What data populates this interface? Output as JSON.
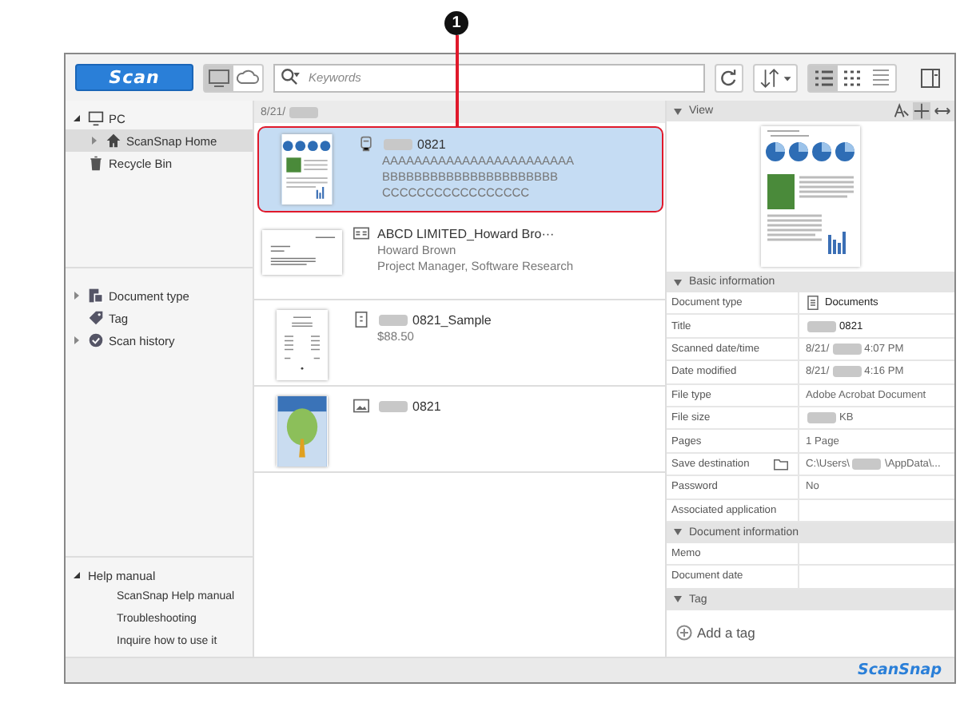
{
  "callout": {
    "label": "1"
  },
  "toolbar": {
    "scan_button": "Scan",
    "search": {
      "placeholder": "Keywords"
    }
  },
  "sidebar": {
    "tree": [
      {
        "label": "PC",
        "expanded": true,
        "selected": false,
        "children": [
          {
            "label": "ScanSnap Home",
            "expanded": false,
            "selected": true
          }
        ]
      },
      {
        "label": "Recycle Bin",
        "selected": false
      }
    ],
    "categories": [
      {
        "label": "Document type",
        "expandable": true
      },
      {
        "label": "Tag",
        "expandable": false
      },
      {
        "label": "Scan history",
        "expandable": true
      }
    ],
    "help": {
      "title": "Help manual",
      "expanded": true,
      "links": [
        "ScanSnap Help manual",
        "Troubleshooting",
        "Inquire how to use it"
      ]
    }
  },
  "list": {
    "date_header": "8/21/",
    "date_redacted": true,
    "items": [
      {
        "kind": "document",
        "title": "0821",
        "redacted": true,
        "lines": [
          "AAAAAAAAAAAAAAAAAAAAAAAA",
          "BBBBBBBBBBBBBBBBBBBBBB",
          "CCCCCCCCCCCCCCCCC"
        ],
        "selected": true
      },
      {
        "kind": "card",
        "title": "ABCD LIMITED_Howard Bro···",
        "redacted": false,
        "lines": [
          "Howard Brown",
          "Project Manager, Software Research"
        ],
        "selected": false
      },
      {
        "kind": "receipt",
        "title": "0821_Sample",
        "redacted": true,
        "lines": [
          "$88.50"
        ],
        "selected": false
      },
      {
        "kind": "photo",
        "title": "0821",
        "redacted": true,
        "selected": false
      }
    ]
  },
  "details": {
    "view": {
      "title": "View",
      "expanded": true
    },
    "sections": [
      {
        "title": "Basic information",
        "expanded": true,
        "rows": [
          {
            "label": "Document type",
            "after": "Documents"
          },
          {
            "label": "Title",
            "redacted": true,
            "after": "0821"
          },
          {
            "label": "Scanned date/time",
            "before": "8/21/",
            "redacted": true,
            "after": "4:07 PM"
          },
          {
            "label": "Date modified",
            "before": "8/21/",
            "redacted": true,
            "after": "4:16 PM"
          },
          {
            "label": "File type",
            "after": "Adobe Acrobat Document"
          },
          {
            "label": "File size",
            "redacted": true,
            "after": "KB"
          },
          {
            "label": "Pages",
            "after": "1 Page"
          },
          {
            "label": "Save destination",
            "before": "C:\\Users\\",
            "redacted": true,
            "after": "\\AppData\\..."
          },
          {
            "label": "Password",
            "after": "No"
          },
          {
            "label": "Associated application"
          }
        ]
      },
      {
        "title": "Document information",
        "expanded": true,
        "rows": [
          {
            "label": "Memo"
          },
          {
            "label": "Document date"
          }
        ]
      },
      {
        "title": "Tag",
        "expanded": true,
        "action": "Add a tag"
      }
    ]
  },
  "footer": {
    "logo": "ScanSnap"
  }
}
